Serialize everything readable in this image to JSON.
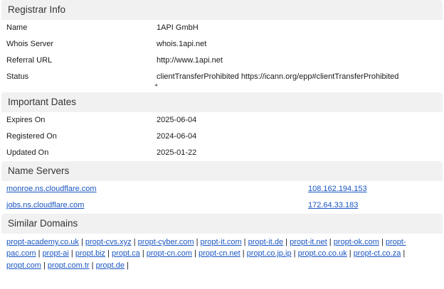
{
  "registrar": {
    "header": "Registrar Info",
    "rows": [
      {
        "label": "Name",
        "value": "1API GmbH"
      },
      {
        "label": "Whois Server",
        "value": "whois.1api.net"
      },
      {
        "label": "Referral URL",
        "value": "http://www.1api.net"
      },
      {
        "label": "Status",
        "value": "clientTransferProhibited https://icann.org/epp#clientTransferProhibited"
      }
    ],
    "status_arrow": "◂"
  },
  "dates": {
    "header": "Important Dates",
    "rows": [
      {
        "label": "Expires On",
        "value": "2025-06-04"
      },
      {
        "label": "Registered On",
        "value": "2024-06-04"
      },
      {
        "label": "Updated On",
        "value": "2025-01-22"
      }
    ]
  },
  "nameservers": {
    "header": "Name Servers",
    "rows": [
      {
        "host": "monroe.ns.cloudflare.com",
        "ip": "108.162.194.153"
      },
      {
        "host": "jobs.ns.cloudflare.com",
        "ip": "172.64.33.183"
      }
    ]
  },
  "similar": {
    "header": "Similar Domains",
    "separator": " | ",
    "lines": [
      [
        "propt-academy.co.uk",
        "propt-cvs.xyz",
        "propt-cyber.com",
        "propt-it.com",
        "propt-it.de",
        "propt-it.net",
        "propt-ok.com",
        "propt-"
      ],
      [
        "pac.com",
        "propt-ai",
        "propt.biz",
        "propt.ca",
        "propt-cn.com",
        "propt-cn.net",
        "propt.co.jp.ip",
        "propt.co.co.uk",
        "propt-ct.co.za",
        ""
      ],
      [
        "propt.com",
        "propt.com.tr",
        "propt.de",
        ""
      ]
    ]
  }
}
